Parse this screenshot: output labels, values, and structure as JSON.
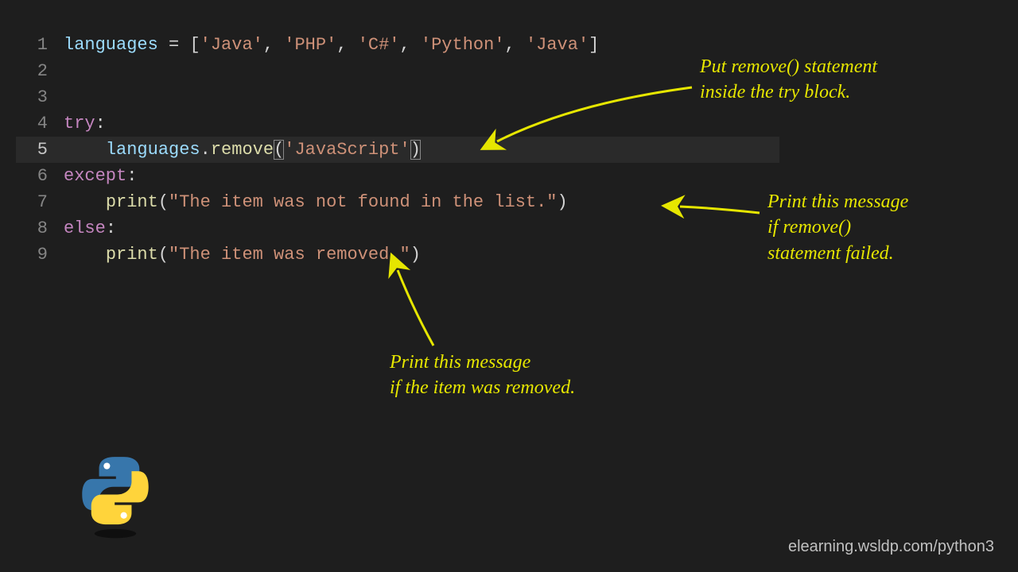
{
  "code": {
    "lines": [
      {
        "n": "1",
        "active": false,
        "tokens": [
          {
            "cls": "tok-var",
            "t": "languages"
          },
          {
            "cls": "tok-op",
            "t": " = "
          },
          {
            "cls": "tok-pun",
            "t": "["
          },
          {
            "cls": "tok-str",
            "t": "'Java'"
          },
          {
            "cls": "tok-pun",
            "t": ", "
          },
          {
            "cls": "tok-str",
            "t": "'PHP'"
          },
          {
            "cls": "tok-pun",
            "t": ", "
          },
          {
            "cls": "tok-str",
            "t": "'C#'"
          },
          {
            "cls": "tok-pun",
            "t": ", "
          },
          {
            "cls": "tok-str",
            "t": "'Python'"
          },
          {
            "cls": "tok-pun",
            "t": ", "
          },
          {
            "cls": "tok-str",
            "t": "'Java'"
          },
          {
            "cls": "tok-pun",
            "t": "]"
          }
        ]
      },
      {
        "n": "2",
        "active": false,
        "tokens": []
      },
      {
        "n": "3",
        "active": false,
        "tokens": []
      },
      {
        "n": "4",
        "active": false,
        "tokens": [
          {
            "cls": "tok-kw",
            "t": "try"
          },
          {
            "cls": "tok-pun",
            "t": ":"
          }
        ]
      },
      {
        "n": "5",
        "active": true,
        "tokens": [
          {
            "cls": "tok-pun",
            "t": "    "
          },
          {
            "cls": "tok-var",
            "t": "languages"
          },
          {
            "cls": "tok-pun",
            "t": "."
          },
          {
            "cls": "tok-fn",
            "t": "remove"
          },
          {
            "cls": "tok-pun bracket-box",
            "t": "("
          },
          {
            "cls": "tok-str",
            "t": "'JavaScript'"
          },
          {
            "cls": "tok-pun bracket-box",
            "t": ")"
          }
        ]
      },
      {
        "n": "6",
        "active": false,
        "tokens": [
          {
            "cls": "tok-kw",
            "t": "except"
          },
          {
            "cls": "tok-pun",
            "t": ":"
          }
        ]
      },
      {
        "n": "7",
        "active": false,
        "tokens": [
          {
            "cls": "tok-pun",
            "t": "    "
          },
          {
            "cls": "tok-fn",
            "t": "print"
          },
          {
            "cls": "tok-pun",
            "t": "("
          },
          {
            "cls": "tok-str",
            "t": "\"The item was not found in the list.\""
          },
          {
            "cls": "tok-pun",
            "t": ")"
          }
        ]
      },
      {
        "n": "8",
        "active": false,
        "tokens": [
          {
            "cls": "tok-kw",
            "t": "else"
          },
          {
            "cls": "tok-pun",
            "t": ":"
          }
        ]
      },
      {
        "n": "9",
        "active": false,
        "tokens": [
          {
            "cls": "tok-pun",
            "t": "    "
          },
          {
            "cls": "tok-fn",
            "t": "print"
          },
          {
            "cls": "tok-pun",
            "t": "("
          },
          {
            "cls": "tok-str",
            "t": "\"The item was removed.\""
          },
          {
            "cls": "tok-pun",
            "t": ")"
          }
        ]
      }
    ]
  },
  "annotations": {
    "top": "Put remove() statement\ninside the try block.",
    "right": "Print this message\nif remove()\nstatement failed.",
    "bottom": "Print this message\nif the item was removed."
  },
  "watermark": "elearning.wsldp.com/python3",
  "colors": {
    "arrow": "#e6e600"
  }
}
